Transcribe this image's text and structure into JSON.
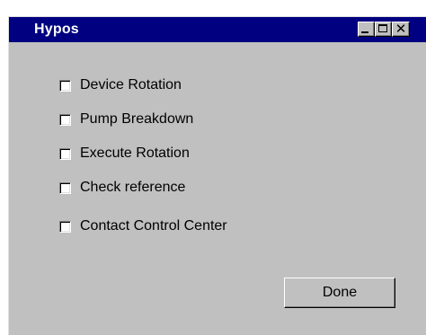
{
  "window": {
    "title": "Hypos",
    "colors": {
      "titlebar": "#000080",
      "face": "#c0c0c0",
      "title_text": "#ffffff"
    },
    "controls": {
      "minimize_icon": "minimize-icon",
      "maximize_icon": "maximize-icon",
      "close_icon": "close-icon",
      "close_glyph": "✕"
    }
  },
  "options": [
    {
      "label": "Device Rotation",
      "checked": false
    },
    {
      "label": "Pump Breakdown",
      "checked": false
    },
    {
      "label": "Execute Rotation",
      "checked": false
    },
    {
      "label": "Check reference",
      "checked": false
    },
    {
      "label": "Contact Control Center",
      "checked": false
    }
  ],
  "done_button": {
    "label": "Done"
  }
}
